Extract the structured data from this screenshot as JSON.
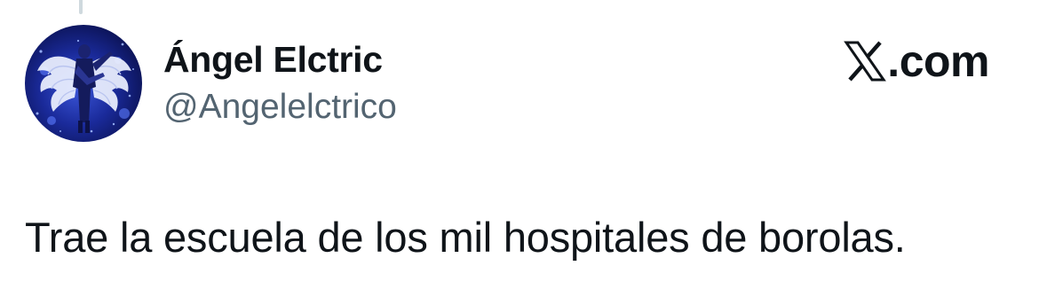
{
  "tweet": {
    "author": {
      "display_name": "Ángel Elctric",
      "handle": "@Angelelctrico",
      "avatar": "angel-wings-photo"
    },
    "brand": {
      "icon": "x-logo-icon",
      "domain_suffix": ".com"
    },
    "text": "Trae la escuela de los mil hospitales de borolas."
  },
  "colors": {
    "text_primary": "#0f1419",
    "text_secondary": "#536471",
    "thread_line": "#cfd9de",
    "background": "#ffffff"
  }
}
